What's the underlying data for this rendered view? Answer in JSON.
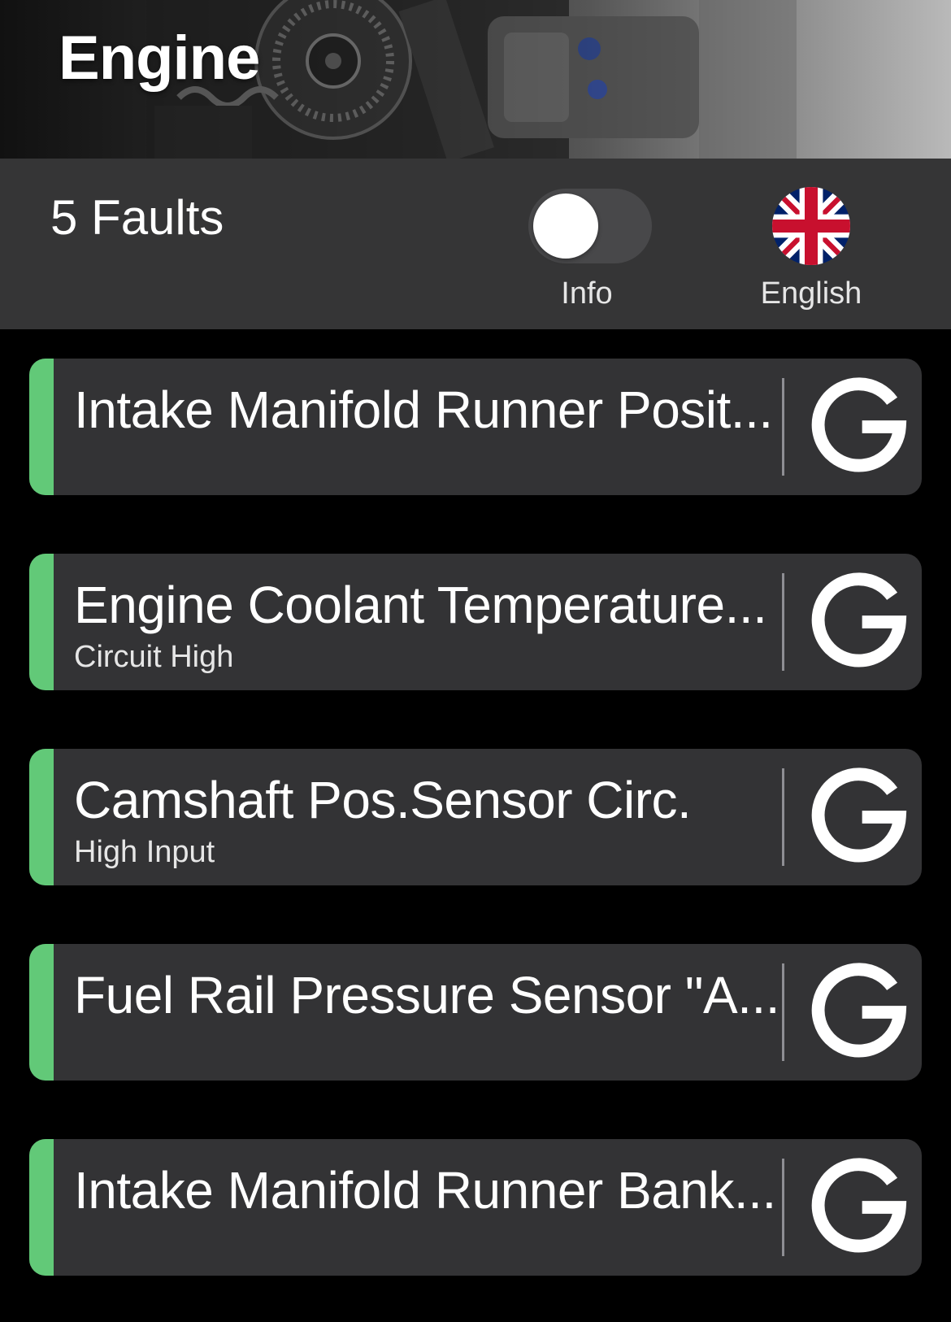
{
  "header": {
    "title": "Engine"
  },
  "status": {
    "fault_count": "5 Faults",
    "info_toggle": {
      "label": "Info",
      "on": false
    },
    "language": {
      "label": "English",
      "flag": "uk-flag-icon"
    }
  },
  "colors": {
    "accent": "#62c978",
    "card_bg": "#333335",
    "status_bg": "#353536"
  },
  "faults": [
    {
      "title": "Intake Manifold Runner Posit...",
      "subtitle": "",
      "action_icon": "google-icon"
    },
    {
      "title": "Engine Coolant Temperature...",
      "subtitle": "Circuit High",
      "action_icon": "google-icon"
    },
    {
      "title": "Camshaft Pos.Sensor Circ.",
      "subtitle": "High Input",
      "action_icon": "google-icon"
    },
    {
      "title": "Fuel Rail Pressure Sensor \"A...",
      "subtitle": "",
      "action_icon": "google-icon"
    },
    {
      "title": "Intake Manifold Runner Bank...",
      "subtitle": "",
      "action_icon": "google-icon"
    }
  ]
}
